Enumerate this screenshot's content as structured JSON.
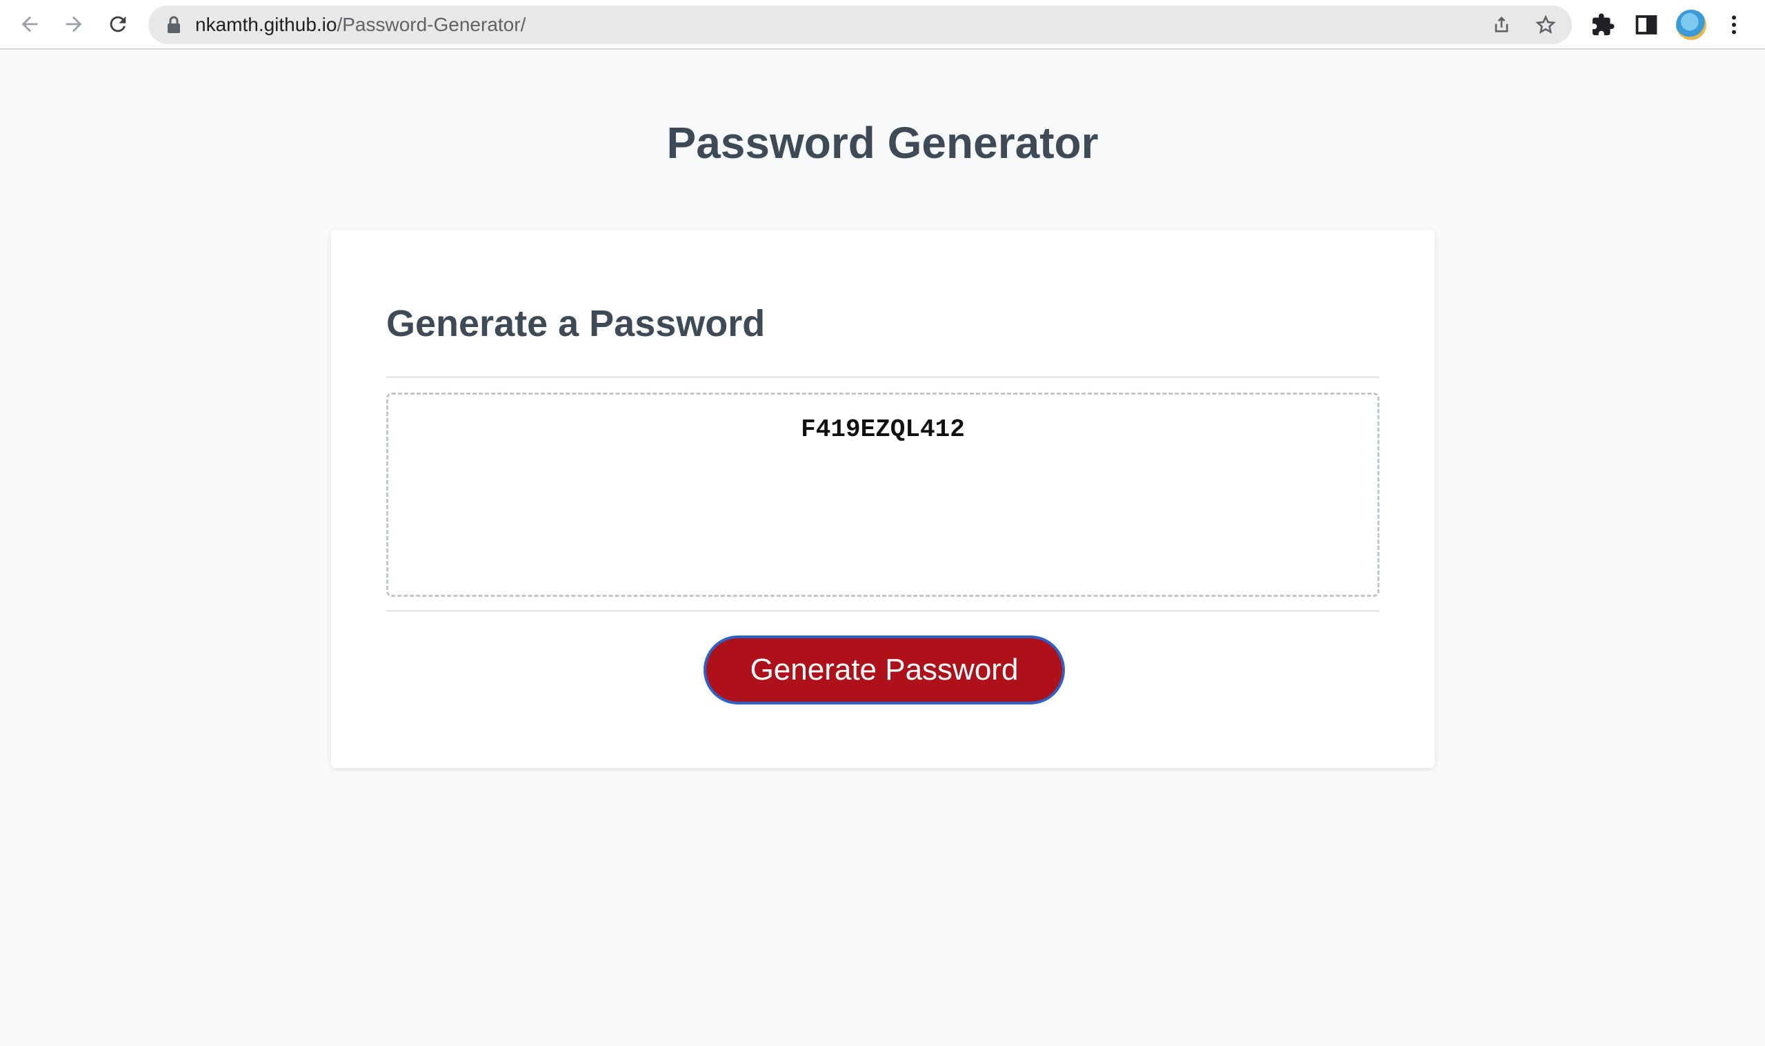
{
  "browser": {
    "url_host": "nkamth.github.io",
    "url_path": "/Password-Generator/"
  },
  "page": {
    "title": "Password Generator"
  },
  "card": {
    "title": "Generate a Password",
    "password_value": "F419EZQL412",
    "button_label": "Generate Password"
  },
  "colors": {
    "button_bg": "#ae1119",
    "button_border": "#2b62c9",
    "heading": "#3e4a56"
  }
}
